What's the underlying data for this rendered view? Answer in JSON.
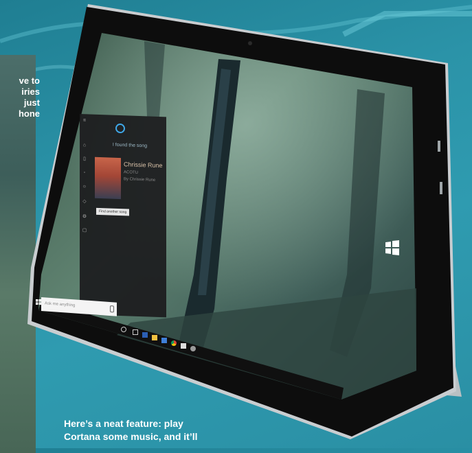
{
  "article": {
    "side_text_lines": [
      "ve to",
      "iries",
      "just",
      "hone"
    ],
    "caption_lines": [
      "Here’s a neat feature: play",
      "Cortana some music, and it’ll"
    ]
  },
  "cortana": {
    "found_text": "I found the song",
    "song_title": "Chrissie Rune",
    "song_artist": "ACOTU",
    "song_album": "By Chrissie Rune",
    "find_another_label": "Find another song",
    "search_placeholder": "Ask me anything"
  },
  "taskbar_icons": [
    "cortana-ring-icon",
    "task-view-icon",
    "word-icon",
    "file-explorer-icon",
    "edge-icon",
    "chrome-icon",
    "mail-icon",
    "settings-icon"
  ],
  "colors": {
    "background": "#2b93a8",
    "bezel": "#0d0d0d",
    "cortana_accent": "#3fa8e8",
    "caption_text": "#ffffff"
  }
}
